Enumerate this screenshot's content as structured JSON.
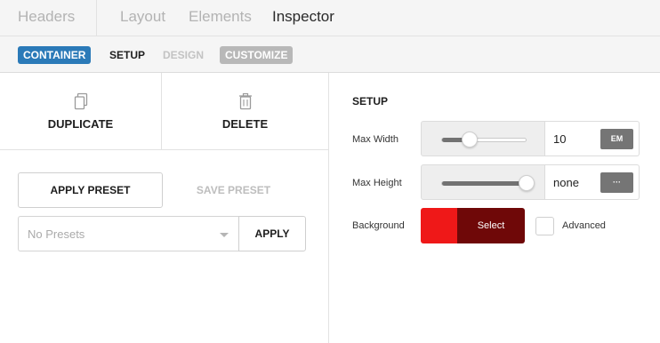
{
  "topnav": {
    "tabs": [
      {
        "label": "Headers",
        "active": false
      },
      {
        "label": "Layout",
        "active": false
      },
      {
        "label": "Elements",
        "active": false
      },
      {
        "label": "Inspector",
        "active": true
      }
    ]
  },
  "subnav": {
    "container": "CONTAINER",
    "setup": "SETUP",
    "design": "DESIGN",
    "customize": "CUSTOMIZE"
  },
  "actions": {
    "duplicate_icon": "copy-icon",
    "duplicate": "DUPLICATE",
    "delete_icon": "trash-icon",
    "delete": "DELETE"
  },
  "presets": {
    "apply_preset": "APPLY PRESET",
    "save_preset": "SAVE PRESET",
    "select_placeholder": "No Presets",
    "apply": "APPLY"
  },
  "setup": {
    "title": "SETUP",
    "max_width": {
      "label": "Max Width",
      "value": "10",
      "unit": "EM",
      "slider_fraction": 0.33
    },
    "max_height": {
      "label": "Max Height",
      "value": "none",
      "unit": "···",
      "slider_fraction": 1.0
    },
    "background": {
      "label": "Background",
      "button": "Select",
      "swatch_color": "#ef1818",
      "button_color": "#6f0808"
    },
    "advanced": {
      "label": "Advanced",
      "checked": false
    }
  },
  "colors": {
    "accent_blue": "#2b7ab8",
    "badge_grey": "#b8b8b8"
  }
}
